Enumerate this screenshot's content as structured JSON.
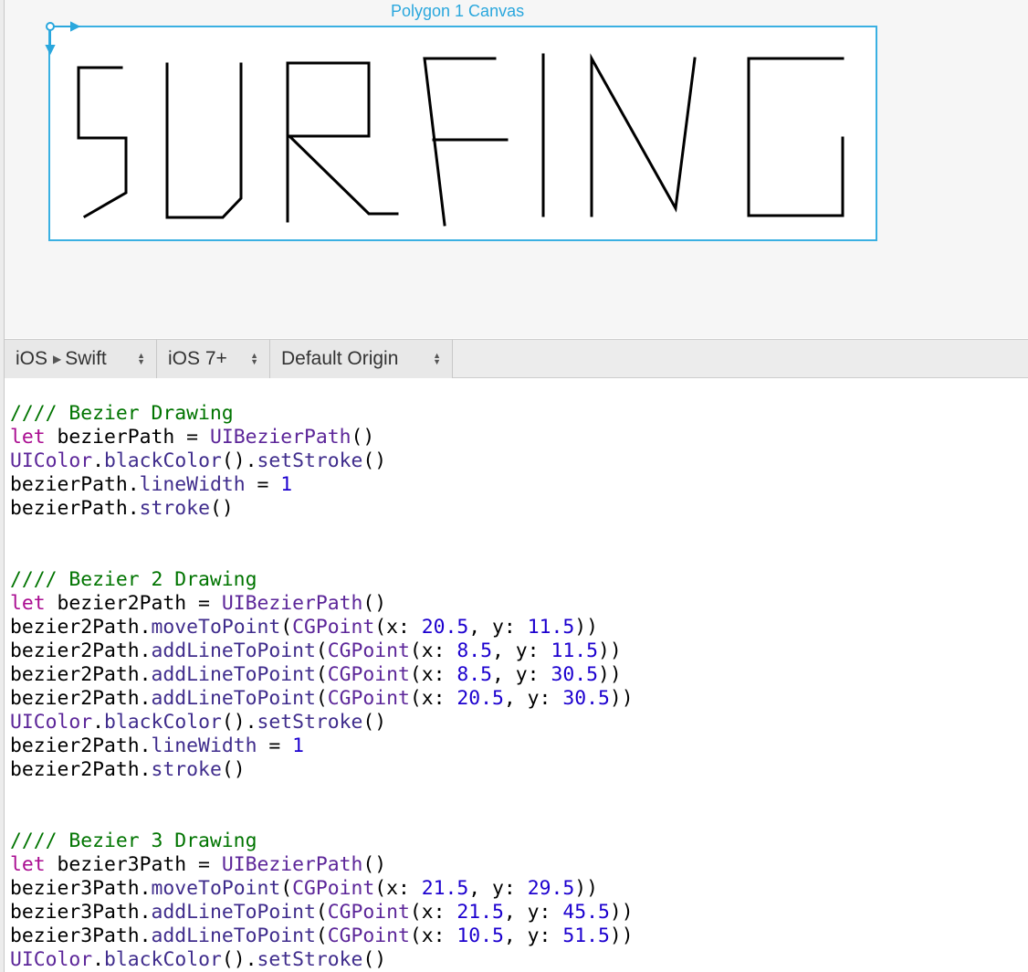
{
  "canvas": {
    "title": "Polygon 1 Canvas",
    "frame_color": "#3ab0e2",
    "drawing_text": "SURFING",
    "stroke_color": "#000000"
  },
  "toolbar": {
    "platform_label": "iOS",
    "language_label": "Swift",
    "version_label": "iOS 7+",
    "origin_label": "Default Origin"
  },
  "colors": {
    "comment": "#007400",
    "keyword": "#aa0d91",
    "type": "#5c2699",
    "method": "#3f2c8c",
    "number": "#1c00cf"
  },
  "code_lines": [
    [
      {
        "t": "//// Bezier Drawing",
        "k": "comment"
      }
    ],
    [
      {
        "t": "let",
        "k": "keyword"
      },
      {
        "t": " bezierPath = ",
        "k": "plain"
      },
      {
        "t": "UIBezierPath",
        "k": "type"
      },
      {
        "t": "()",
        "k": "plain"
      }
    ],
    [
      {
        "t": "UIColor",
        "k": "type"
      },
      {
        "t": ".",
        "k": "plain"
      },
      {
        "t": "blackColor",
        "k": "method"
      },
      {
        "t": "().",
        "k": "plain"
      },
      {
        "t": "setStroke",
        "k": "method"
      },
      {
        "t": "()",
        "k": "plain"
      }
    ],
    [
      {
        "t": "bezierPath.",
        "k": "plain"
      },
      {
        "t": "lineWidth",
        "k": "method"
      },
      {
        "t": " = ",
        "k": "plain"
      },
      {
        "t": "1",
        "k": "number"
      }
    ],
    [
      {
        "t": "bezierPath.",
        "k": "plain"
      },
      {
        "t": "stroke",
        "k": "method"
      },
      {
        "t": "()",
        "k": "plain"
      }
    ],
    [],
    [],
    [
      {
        "t": "//// Bezier 2 Drawing",
        "k": "comment"
      }
    ],
    [
      {
        "t": "let",
        "k": "keyword"
      },
      {
        "t": " bezier2Path = ",
        "k": "plain"
      },
      {
        "t": "UIBezierPath",
        "k": "type"
      },
      {
        "t": "()",
        "k": "plain"
      }
    ],
    [
      {
        "t": "bezier2Path.",
        "k": "plain"
      },
      {
        "t": "moveToPoint",
        "k": "method"
      },
      {
        "t": "(",
        "k": "plain"
      },
      {
        "t": "CGPoint",
        "k": "type"
      },
      {
        "t": "(x: ",
        "k": "plain"
      },
      {
        "t": "20.5",
        "k": "number"
      },
      {
        "t": ", y: ",
        "k": "plain"
      },
      {
        "t": "11.5",
        "k": "number"
      },
      {
        "t": "))",
        "k": "plain"
      }
    ],
    [
      {
        "t": "bezier2Path.",
        "k": "plain"
      },
      {
        "t": "addLineToPoint",
        "k": "method"
      },
      {
        "t": "(",
        "k": "plain"
      },
      {
        "t": "CGPoint",
        "k": "type"
      },
      {
        "t": "(x: ",
        "k": "plain"
      },
      {
        "t": "8.5",
        "k": "number"
      },
      {
        "t": ", y: ",
        "k": "plain"
      },
      {
        "t": "11.5",
        "k": "number"
      },
      {
        "t": "))",
        "k": "plain"
      }
    ],
    [
      {
        "t": "bezier2Path.",
        "k": "plain"
      },
      {
        "t": "addLineToPoint",
        "k": "method"
      },
      {
        "t": "(",
        "k": "plain"
      },
      {
        "t": "CGPoint",
        "k": "type"
      },
      {
        "t": "(x: ",
        "k": "plain"
      },
      {
        "t": "8.5",
        "k": "number"
      },
      {
        "t": ", y: ",
        "k": "plain"
      },
      {
        "t": "30.5",
        "k": "number"
      },
      {
        "t": "))",
        "k": "plain"
      }
    ],
    [
      {
        "t": "bezier2Path.",
        "k": "plain"
      },
      {
        "t": "addLineToPoint",
        "k": "method"
      },
      {
        "t": "(",
        "k": "plain"
      },
      {
        "t": "CGPoint",
        "k": "type"
      },
      {
        "t": "(x: ",
        "k": "plain"
      },
      {
        "t": "20.5",
        "k": "number"
      },
      {
        "t": ", y: ",
        "k": "plain"
      },
      {
        "t": "30.5",
        "k": "number"
      },
      {
        "t": "))",
        "k": "plain"
      }
    ],
    [
      {
        "t": "UIColor",
        "k": "type"
      },
      {
        "t": ".",
        "k": "plain"
      },
      {
        "t": "blackColor",
        "k": "method"
      },
      {
        "t": "().",
        "k": "plain"
      },
      {
        "t": "setStroke",
        "k": "method"
      },
      {
        "t": "()",
        "k": "plain"
      }
    ],
    [
      {
        "t": "bezier2Path.",
        "k": "plain"
      },
      {
        "t": "lineWidth",
        "k": "method"
      },
      {
        "t": " = ",
        "k": "plain"
      },
      {
        "t": "1",
        "k": "number"
      }
    ],
    [
      {
        "t": "bezier2Path.",
        "k": "plain"
      },
      {
        "t": "stroke",
        "k": "method"
      },
      {
        "t": "()",
        "k": "plain"
      }
    ],
    [],
    [],
    [
      {
        "t": "//// Bezier 3 Drawing",
        "k": "comment"
      }
    ],
    [
      {
        "t": "let",
        "k": "keyword"
      },
      {
        "t": " bezier3Path = ",
        "k": "plain"
      },
      {
        "t": "UIBezierPath",
        "k": "type"
      },
      {
        "t": "()",
        "k": "plain"
      }
    ],
    [
      {
        "t": "bezier3Path.",
        "k": "plain"
      },
      {
        "t": "moveToPoint",
        "k": "method"
      },
      {
        "t": "(",
        "k": "plain"
      },
      {
        "t": "CGPoint",
        "k": "type"
      },
      {
        "t": "(x: ",
        "k": "plain"
      },
      {
        "t": "21.5",
        "k": "number"
      },
      {
        "t": ", y: ",
        "k": "plain"
      },
      {
        "t": "29.5",
        "k": "number"
      },
      {
        "t": "))",
        "k": "plain"
      }
    ],
    [
      {
        "t": "bezier3Path.",
        "k": "plain"
      },
      {
        "t": "addLineToPoint",
        "k": "method"
      },
      {
        "t": "(",
        "k": "plain"
      },
      {
        "t": "CGPoint",
        "k": "type"
      },
      {
        "t": "(x: ",
        "k": "plain"
      },
      {
        "t": "21.5",
        "k": "number"
      },
      {
        "t": ", y: ",
        "k": "plain"
      },
      {
        "t": "45.5",
        "k": "number"
      },
      {
        "t": "))",
        "k": "plain"
      }
    ],
    [
      {
        "t": "bezier3Path.",
        "k": "plain"
      },
      {
        "t": "addLineToPoint",
        "k": "method"
      },
      {
        "t": "(",
        "k": "plain"
      },
      {
        "t": "CGPoint",
        "k": "type"
      },
      {
        "t": "(x: ",
        "k": "plain"
      },
      {
        "t": "10.5",
        "k": "number"
      },
      {
        "t": ", y: ",
        "k": "plain"
      },
      {
        "t": "51.5",
        "k": "number"
      },
      {
        "t": "))",
        "k": "plain"
      }
    ],
    [
      {
        "t": "UIColor",
        "k": "type"
      },
      {
        "t": ".",
        "k": "plain"
      },
      {
        "t": "blackColor",
        "k": "method"
      },
      {
        "t": "().",
        "k": "plain"
      },
      {
        "t": "setStroke",
        "k": "method"
      },
      {
        "t": "()",
        "k": "plain"
      }
    ]
  ]
}
